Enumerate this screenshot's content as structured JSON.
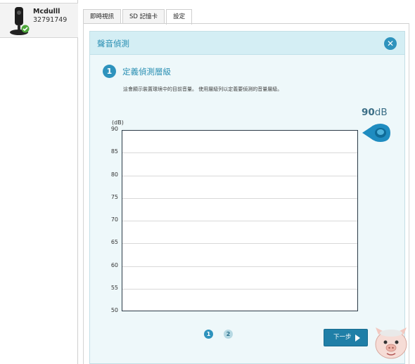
{
  "device": {
    "name": "Mcdulll",
    "id": "32791749"
  },
  "tabs": [
    {
      "label": "即時視訊"
    },
    {
      "label": "SD 記憶卡"
    },
    {
      "label": "設定"
    }
  ],
  "dialog": {
    "title": "聲音偵測",
    "close_icon": "close-icon",
    "step_number": "1",
    "step_title": "定義偵測層級",
    "description": "這會顯示裝置環境中的目前音量。 使用層級列以定義要偵測的音量層級。"
  },
  "level": {
    "value": "90",
    "unit": "dB"
  },
  "chart_data": {
    "type": "line",
    "ylabel": "(dB)",
    "yticks": [
      "90",
      "85",
      "80",
      "75",
      "70",
      "65",
      "60",
      "55",
      "50"
    ],
    "ylim": [
      50,
      90
    ],
    "grid": true,
    "threshold": 90,
    "series": []
  },
  "pager": {
    "pages": [
      "1",
      "2"
    ],
    "current": "1"
  },
  "next_button": {
    "label": "下一步"
  },
  "colors": {
    "accent": "#2e93bd",
    "header_bg": "#d4eef4",
    "dialog_bg": "#eef8fa",
    "button": "#1f7fa7"
  }
}
